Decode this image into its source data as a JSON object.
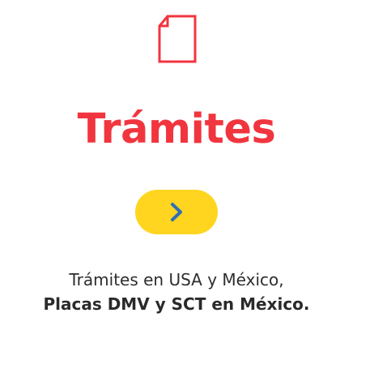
{
  "card": {
    "icon": "document-icon",
    "title": "Trámites",
    "button_icon": "chevron-right-icon",
    "description_line1": "Trámites en USA y México,",
    "description_line2": "Placas DMV y SCT en México."
  },
  "colors": {
    "title": "#f1353f",
    "icon_stroke": "#f1353f",
    "button_bg": "#ffd51f",
    "chevron": "#2f6fb3",
    "text": "#2d2d2d"
  }
}
